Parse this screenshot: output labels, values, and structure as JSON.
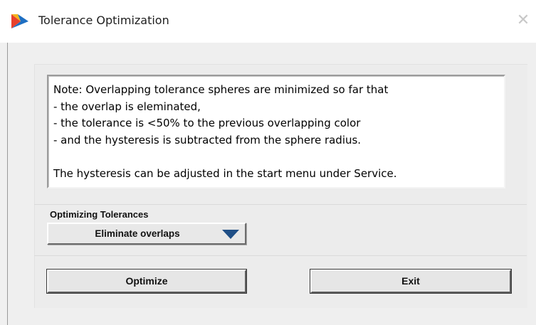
{
  "window": {
    "title": "Tolerance Optimization",
    "app_icon": "app-logo-icon",
    "close_icon": "close-icon",
    "close_glyph": "✕"
  },
  "note": {
    "lines": [
      "Note: Overlapping tolerance spheres are minimized so far that",
      "- the overlap is eleminated,",
      "- the tolerance is <50% to the previous overlapping color",
      "- and the hysteresis is subtracted from the sphere radius.",
      "",
      "The hysteresis can be adjusted in the start menu under Service."
    ]
  },
  "optimizing": {
    "label": "Optimizing Tolerances",
    "selected": "Eliminate overlaps",
    "arrow_color": "#1f4f86"
  },
  "buttons": {
    "optimize": "Optimize",
    "exit": "Exit"
  },
  "colors": {
    "logo_red": "#e8412c",
    "logo_yellow": "#f4b21c",
    "logo_blue": "#1e6fc2"
  }
}
